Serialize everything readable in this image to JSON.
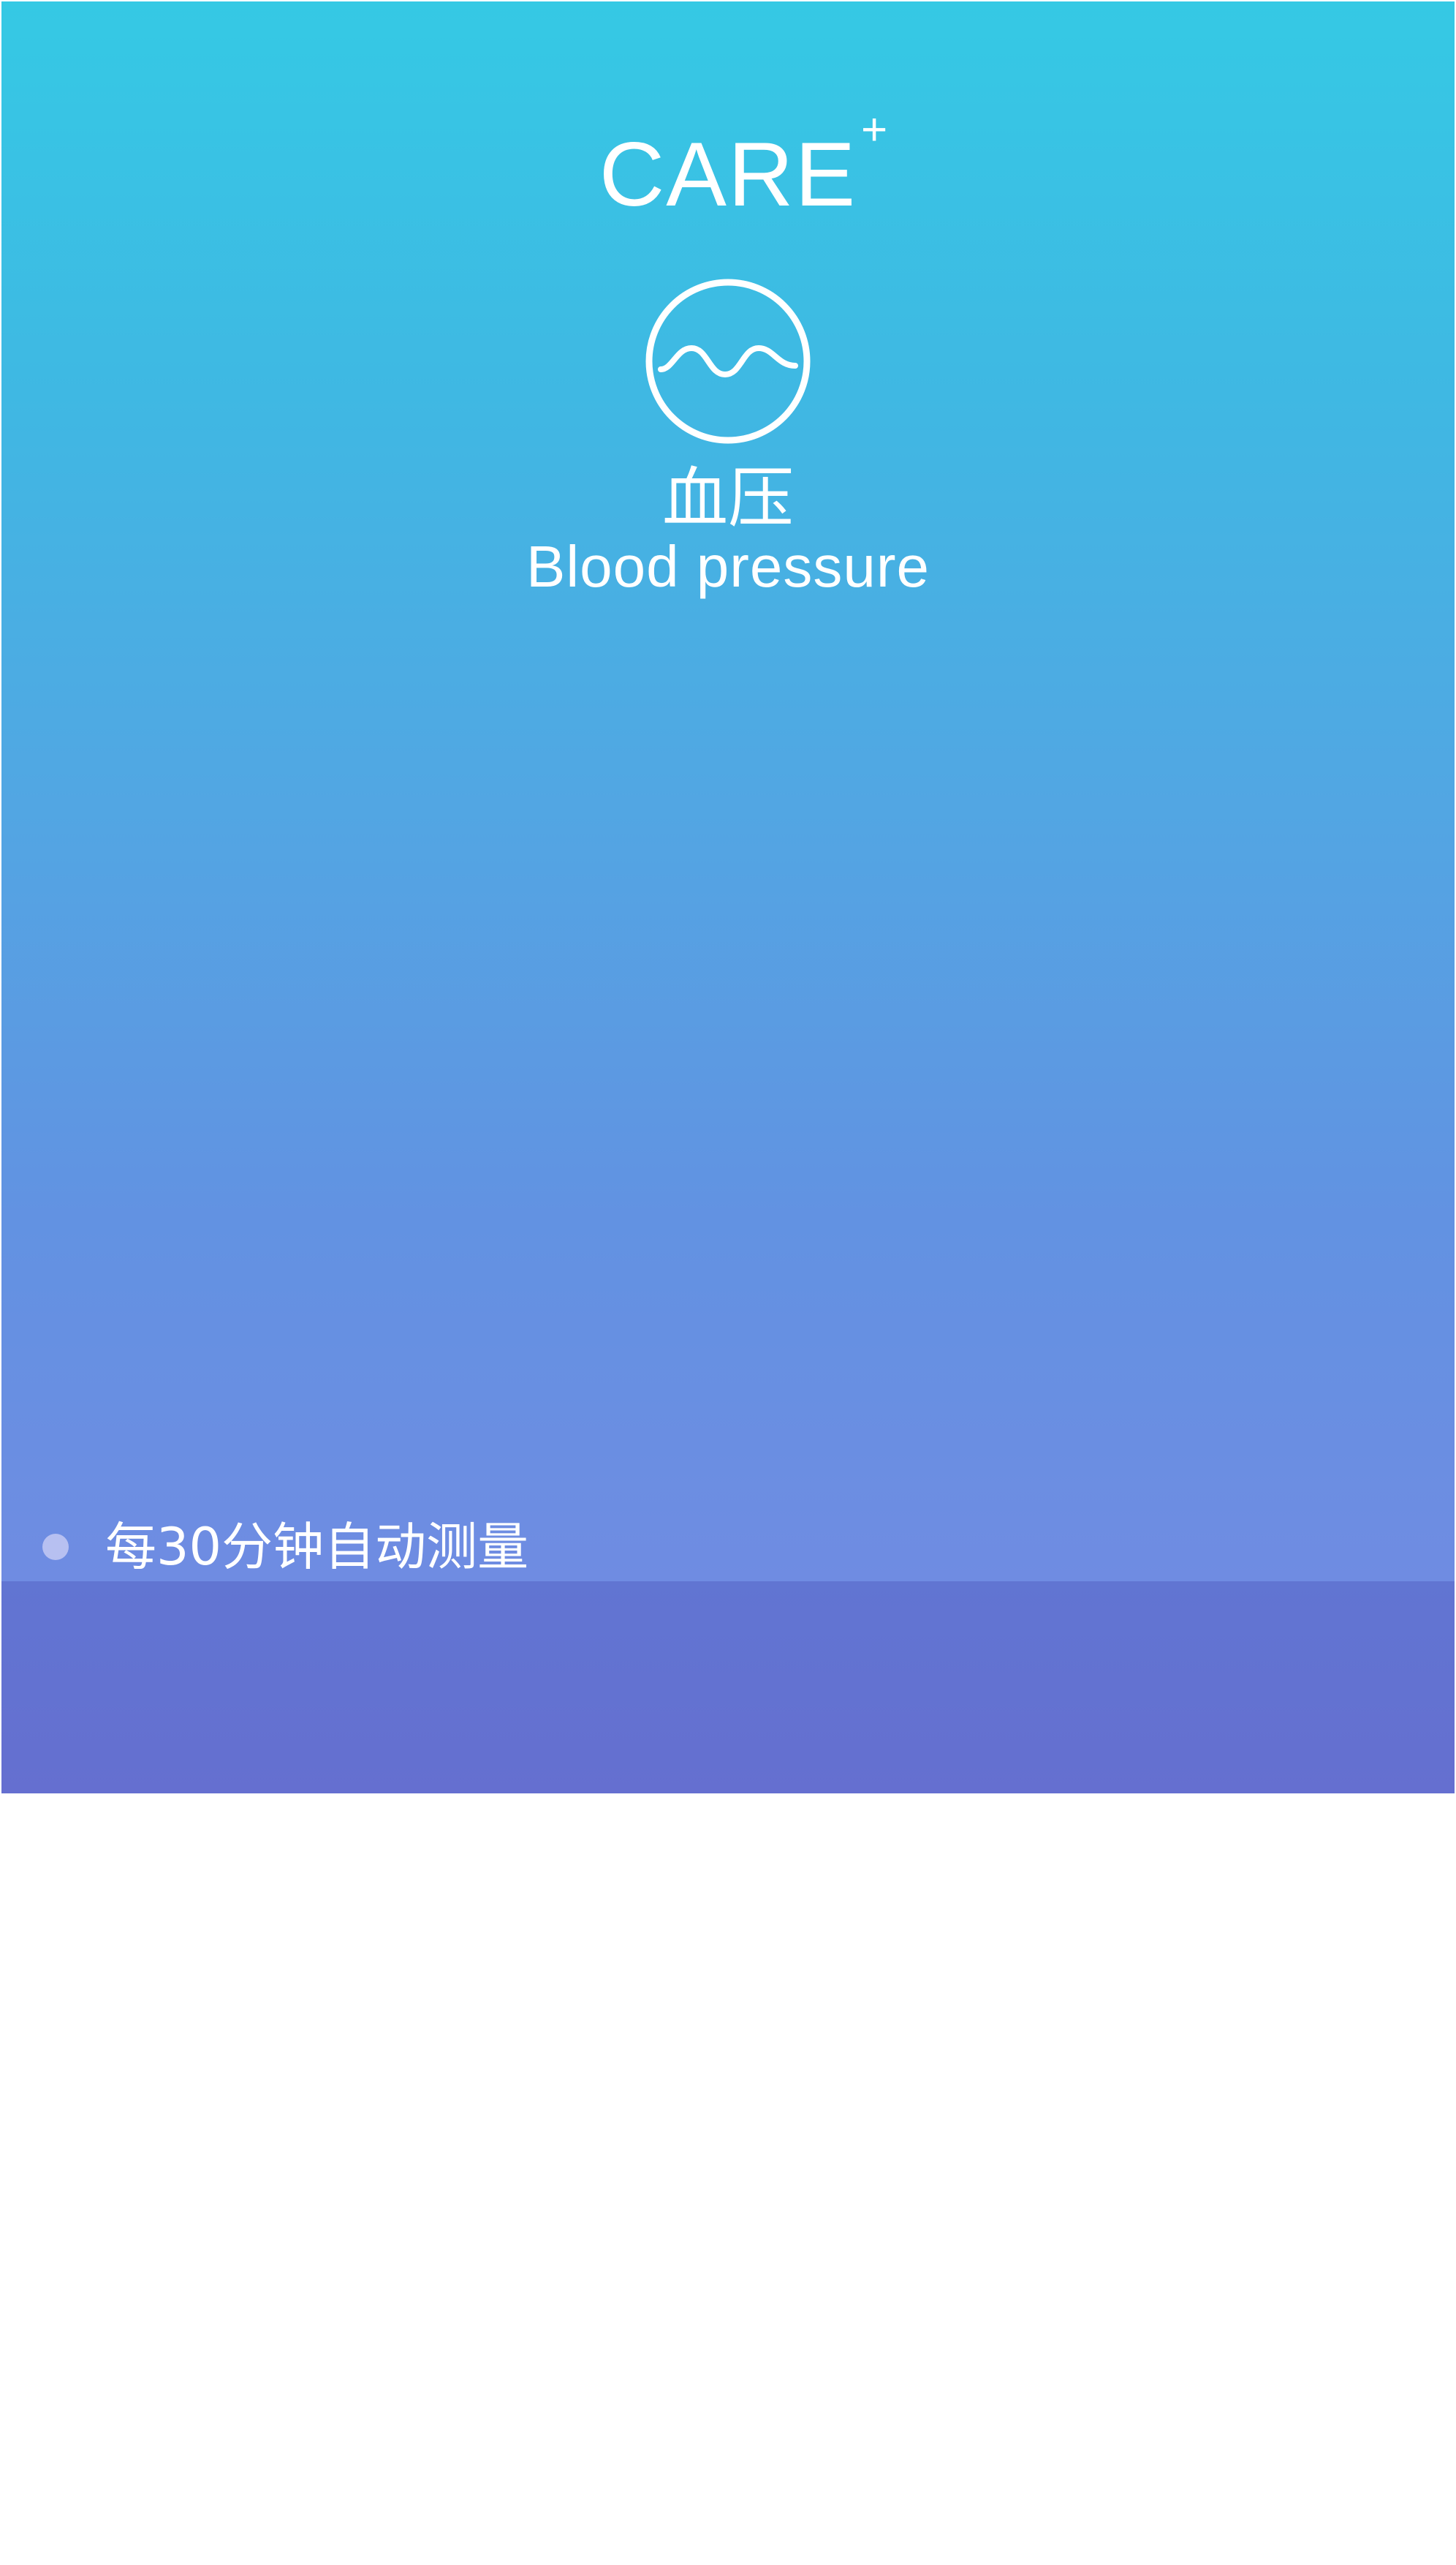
{
  "brand": {
    "logo_text": "CARE",
    "logo_mark": "+"
  },
  "header": {
    "icon": "wave-circle-icon",
    "title_cn": "血压",
    "title_en": "Blood pressure"
  },
  "features": [
    {
      "text": "每30分钟自动测量"
    }
  ],
  "colors": {
    "gradient_top": "#35c9e4",
    "gradient_bottom": "#6f8ce2",
    "bottom_band": "#6274d2",
    "bullet": "#b7c0f1",
    "text": "#ffffff"
  }
}
